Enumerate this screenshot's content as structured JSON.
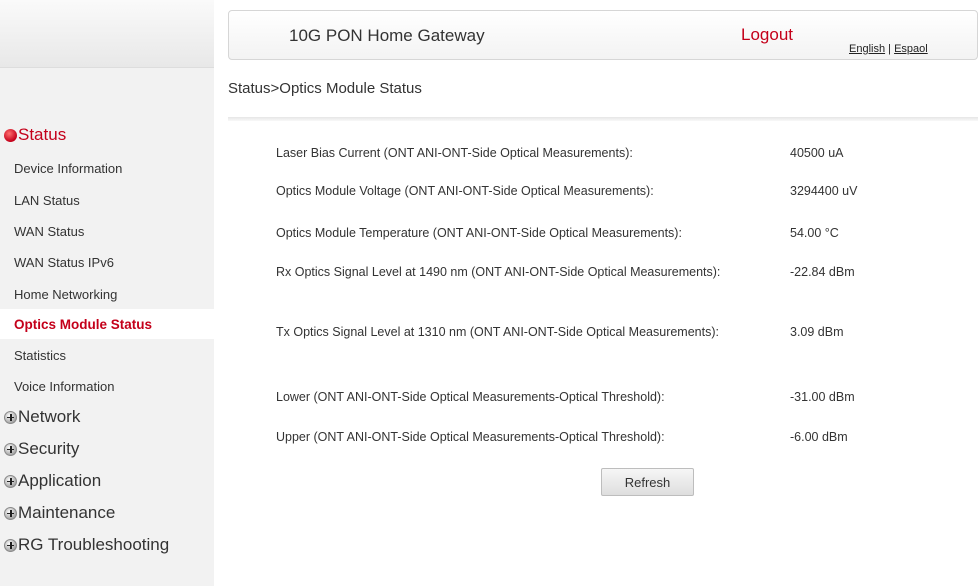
{
  "header": {
    "title": "10G PON Home Gateway",
    "logout": "Logout",
    "lang_english": "English",
    "lang_sep": " | ",
    "lang_espanol": "Espaol"
  },
  "breadcrumb": "Status>Optics Module Status",
  "sidebar": {
    "status_group": "Status",
    "status_items": [
      "Device Information",
      "LAN Status",
      "WAN Status",
      "WAN Status IPv6",
      "Home Networking",
      "Optics Module Status",
      "Statistics",
      "Voice Information"
    ],
    "selected_item": "Optics Module Status",
    "groups": [
      "Network",
      "Security",
      "Application",
      "Maintenance",
      "RG Troubleshooting"
    ]
  },
  "rows": [
    {
      "label": "Laser Bias Current (ONT ANI-ONT-Side Optical Measurements):",
      "value": "40500 uA"
    },
    {
      "label": "Optics Module Voltage (ONT ANI-ONT-Side Optical Measurements):",
      "value": "3294400 uV"
    },
    {
      "label": "Optics Module Temperature (ONT ANI-ONT-Side Optical Measurements):",
      "value": "54.00 °C"
    },
    {
      "label": "Rx Optics Signal Level at 1490 nm (ONT ANI-ONT-Side Optical Measurements):",
      "value": "-22.84 dBm"
    },
    {
      "label": "Tx Optics Signal Level at 1310 nm (ONT ANI-ONT-Side Optical Measurements):",
      "value": "3.09 dBm"
    },
    {
      "label": "Lower (ONT ANI-ONT-Side Optical Measurements-Optical Threshold):",
      "value": "-31.00 dBm"
    },
    {
      "label": "Upper (ONT ANI-ONT-Side Optical Measurements-Optical Threshold):",
      "value": "-6.00 dBm"
    }
  ],
  "refresh_label": "Refresh",
  "colors": {
    "accent": "#c4001a",
    "sidebar_bg": "#f2f2f2"
  },
  "icons": {
    "status_group": "red-bullet-icon",
    "collapsed_group": "plus-icon"
  }
}
